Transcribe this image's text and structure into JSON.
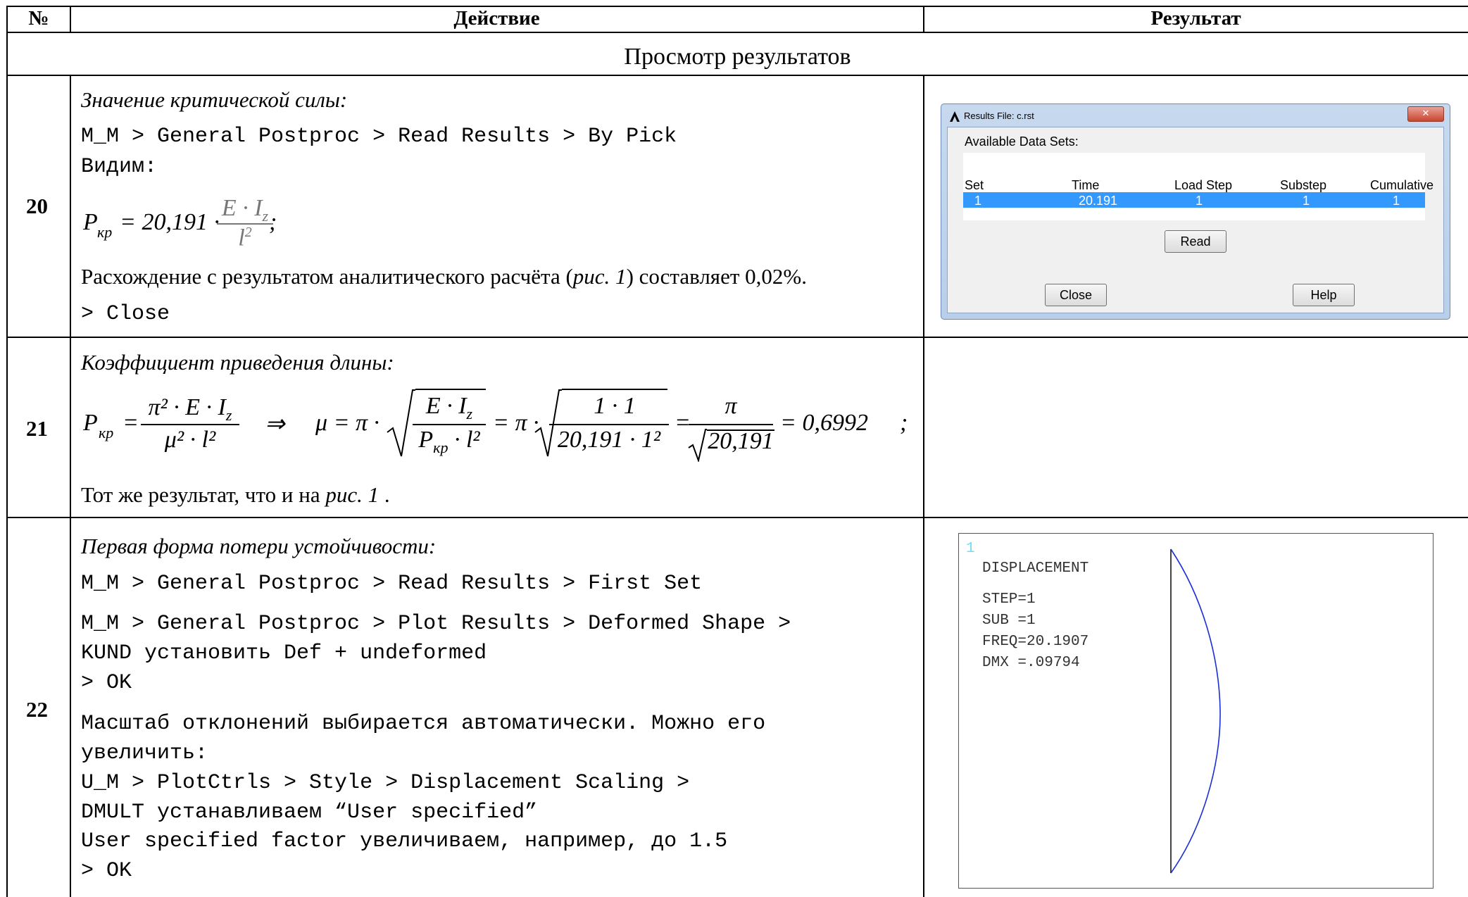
{
  "header": {
    "num": "№",
    "action": "Действие",
    "result": "Результат"
  },
  "section_title": "Просмотр результатов",
  "rows": {
    "r20": {
      "num": "20",
      "heading": "Значение критической силы:",
      "path": "M_M > General Postproc > Read Results > By Pick",
      "seen": "Видим:",
      "formula": {
        "lhs": "P",
        "lhs_sub": "кр",
        "eq": "= 20,191 ·",
        "num": "E · I",
        "num_sub": "z",
        "den": "l",
        "den_sup": "2",
        "tail": ";"
      },
      "discrepancy_pre": "Расхождение с результатом аналитического расчёта (",
      "discrepancy_ref": "рис. 1",
      "discrepancy_post": ") составляет 0,02%.",
      "close": "> Close"
    },
    "r21": {
      "num": "21",
      "heading": "Коэффициент приведения длины:",
      "formula": {
        "P": "P",
        "P_sub": "кр",
        "f1_num": "π² · E · I",
        "f1_num_sub": "z",
        "f1_den": "μ² · l²",
        "arrow": "⇒",
        "mu": "μ = π ·",
        "f2_num": "E · I",
        "f2_num_sub": "z",
        "f2_den": "P",
        "f2_den_sub": "кр",
        "f2_den_tail": " · l²",
        "eq_pi": "= π ·",
        "f3_num": "1 · 1",
        "f3_den": "20,191 · 1²",
        "eq": "=",
        "f4_num": "π",
        "f4_den": "20,191",
        "result": "= 0,6992",
        "tail": ";"
      },
      "same_pre": "Тот же результат, что и на ",
      "same_ref": "рис. 1",
      "same_post": " ."
    },
    "r22": {
      "num": "22",
      "heading": "Первая форма потери устойчивости:",
      "lines": [
        "M_M > General Postproc > Read Results > First Set",
        "M_M > General Postproc > Plot Results > Deformed Shape >",
        "KUND установить Def + undeformed",
        "> OK",
        "Масштаб отклонений выбирается автоматически. Можно его",
        "увеличить:",
        "U_M > PlotCtrls > Style > Displacement Scaling >",
        "DMULT устанавливаем “User specified”",
        "User specified factor увеличиваем, например, до 1.5",
        "> OK"
      ]
    }
  },
  "dialog": {
    "title": "Results File: c.rst",
    "close_x": "✕",
    "available": "Available Data Sets:",
    "columns": [
      "Set",
      "Time",
      "Load Step",
      "Substep",
      "Cumulative"
    ],
    "row": [
      "1",
      "20.191",
      "1",
      "1",
      "1"
    ],
    "read": "Read",
    "close": "Close",
    "help": "Help"
  },
  "plot": {
    "window_num": "1",
    "title": "DISPLACEMENT",
    "step": "STEP=1",
    "sub": "SUB =1",
    "freq": "FREQ=20.1907",
    "dmx": "DMX =.09794"
  }
}
